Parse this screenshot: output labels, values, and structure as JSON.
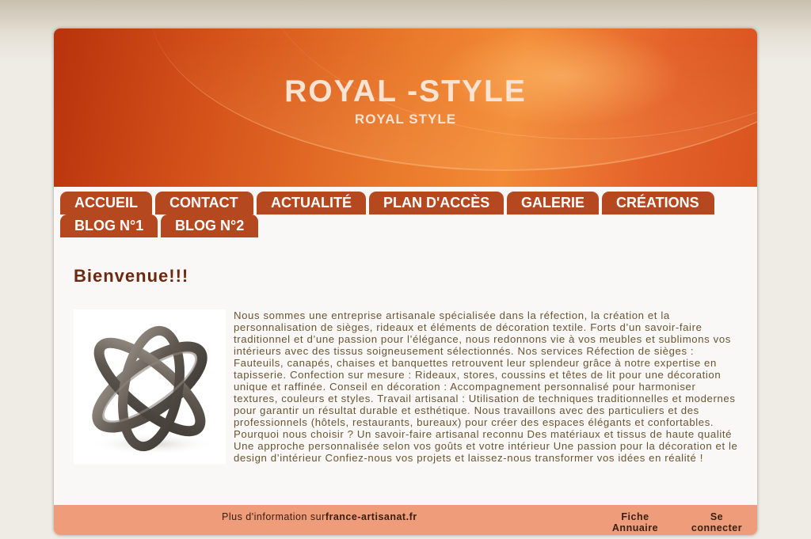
{
  "header": {
    "title": "ROYAL -STYLE",
    "subtitle": "ROYAL STYLE"
  },
  "nav": {
    "items": [
      {
        "label": "ACCUEIL"
      },
      {
        "label": "CONTACT"
      },
      {
        "label": "ACTUALITÉ"
      },
      {
        "label": "PLAN D'ACCÈS"
      },
      {
        "label": "GALERIE"
      },
      {
        "label": "CRÉATIONS"
      },
      {
        "label": "BLOG N°1"
      },
      {
        "label": "BLOG N°2"
      }
    ]
  },
  "main": {
    "heading": "Bienvenue!!!",
    "body": "Nous sommes une entreprise artisanale spécialisée dans la réfection, la création et la personnalisation de sièges, rideaux et éléments de décoration textile. Forts d’un savoir-faire traditionnel et d’une passion pour l’élégance, nous redonnons vie à vos meubles et sublimons vos intérieurs avec des tissus soigneusement sélectionnés. Nos services Réfection de sièges : Fauteuils, canapés, chaises et banquettes retrouvent leur splendeur grâce à notre expertise en tapisserie. Confection sur mesure : Rideaux, stores, coussins et têtes de lit pour une décoration unique et raffinée. Conseil en décoration : Accompagnement personnalisé pour harmoniser textures, couleurs et styles. Travail artisanal : Utilisation de techniques traditionnelles et modernes pour garantir un résultat durable et esthétique. Nous travaillons avec des particuliers et des professionnels (hôtels, restaurants, bureaux) pour créer des espaces élégants et confortables. Pourquoi nous choisir ? Un savoir-faire artisanal reconnu Des matériaux et tissus de haute qualité Une approche personnalisée selon vos goûts et votre intérieur Une passion pour la décoration et le design d’intérieur Confiez-nous vos projets et laissez-nous transformer vos idées en réalité !"
  },
  "footer": {
    "info_prefix": "Plus d'information sur",
    "info_site": "france-artisanat.fr",
    "link_fiche_line1": "Fiche",
    "link_fiche_line2": "Annuaire",
    "link_login_line1": "Se",
    "link_login_line2": "connecter"
  },
  "colors": {
    "nav_button": "#b5481f",
    "heading": "#6b2a10",
    "footer": "#ee9c7a",
    "banner_accent": "#ea7a2c"
  },
  "icons": {
    "sculpture": "sculpture-image"
  }
}
